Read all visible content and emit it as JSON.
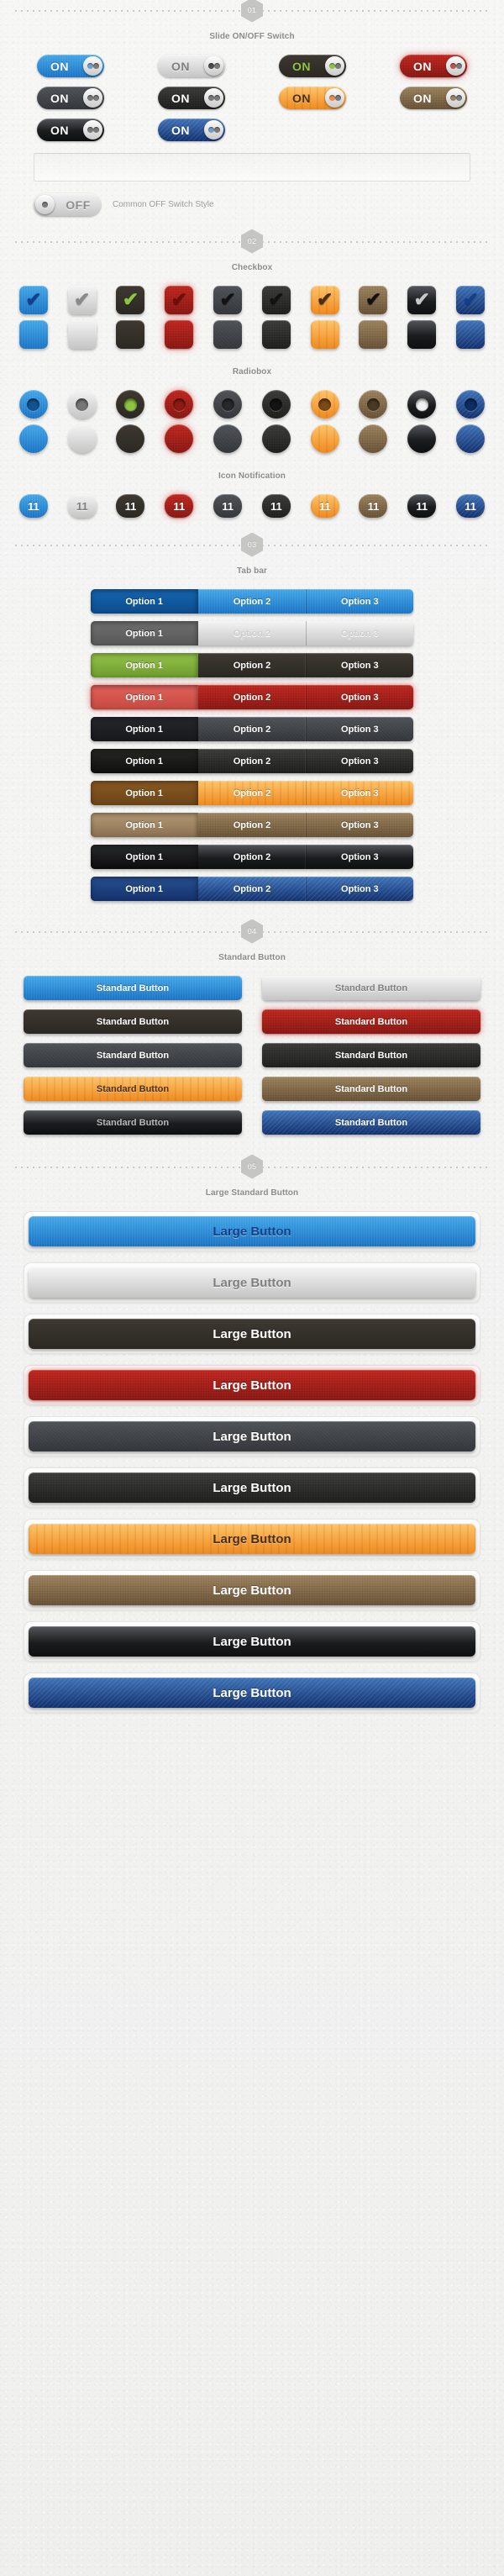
{
  "sections": [
    {
      "badge": "01",
      "title": "Slide ON/OFF Switch"
    },
    {
      "badge": "02",
      "title": "Checkbox"
    },
    {
      "badge": "03",
      "title": "Tab bar"
    },
    {
      "badge": "04",
      "title": "Standard Button"
    },
    {
      "badge": "05",
      "title": "Large Standard Button"
    }
  ],
  "subtitles": {
    "radiobox": "Radiobox",
    "icon_notification": "Icon Notification"
  },
  "switches": {
    "on_label": "ON",
    "off_label": "OFF",
    "off_caption": "Common OFF Switch Style",
    "items": [
      {
        "theme": "blue",
        "label": "ON",
        "text_class": "c-white",
        "knob": "k-blue"
      },
      {
        "theme": "silver",
        "label": "ON",
        "text_class": "c-gray",
        "knob": "k-dark"
      },
      {
        "theme": "darkgreen",
        "label": "ON",
        "text_class": "c-green",
        "knob": "k-green"
      },
      {
        "theme": "red",
        "label": "ON",
        "text_class": "c-white",
        "knob": "k-red"
      },
      {
        "theme": "charcoal",
        "label": "ON",
        "text_class": "c-white",
        "knob": "k-gray"
      },
      {
        "theme": "black",
        "label": "ON",
        "text_class": "c-white",
        "knob": "k-gray"
      },
      {
        "theme": "wood",
        "label": "ON",
        "text_class": "c-darkbr",
        "knob": "k-orange"
      },
      {
        "theme": "brown",
        "label": "ON",
        "text_class": "c-white",
        "knob": "k-brown"
      },
      {
        "theme": "gloss",
        "label": "ON",
        "text_class": "c-white",
        "knob": "k-gray"
      },
      {
        "theme": "denim",
        "label": "ON",
        "text_class": "c-white",
        "knob": "k-blue"
      }
    ]
  },
  "checkbox": {
    "checked_glyph": "✔",
    "items": [
      {
        "theme": "blue",
        "tick_class": "c-navy"
      },
      {
        "theme": "silver",
        "tick_class": "c-gray"
      },
      {
        "theme": "darkgreen",
        "tick_class": "c-green"
      },
      {
        "theme": "red",
        "tick_class": "c-darkred"
      },
      {
        "theme": "charcoal",
        "tick_class": "c-blackish"
      },
      {
        "theme": "black",
        "tick_class": "c-blackish"
      },
      {
        "theme": "wood",
        "tick_class": "c-darkbr"
      },
      {
        "theme": "brown",
        "tick_class": "c-blackish"
      },
      {
        "theme": "gloss",
        "tick_class": "c-silvertxt"
      },
      {
        "theme": "denim",
        "tick_class": "c-navy"
      }
    ]
  },
  "radiobox": {
    "items": [
      {
        "theme": "blue",
        "dot": "d-blue"
      },
      {
        "theme": "silver",
        "dot": "d-gray"
      },
      {
        "theme": "darkgreen",
        "dot": "d-green"
      },
      {
        "theme": "red",
        "dot": "d-red"
      },
      {
        "theme": "charcoal",
        "dot": "d-dark"
      },
      {
        "theme": "black",
        "dot": "d-black"
      },
      {
        "theme": "wood",
        "dot": "d-wood"
      },
      {
        "theme": "brown",
        "dot": "d-brown"
      },
      {
        "theme": "gloss",
        "dot": "d-white"
      },
      {
        "theme": "denim",
        "dot": "d-navy"
      }
    ]
  },
  "notification": {
    "count": "11",
    "items": [
      {
        "theme": "blue",
        "text_class": "c-white"
      },
      {
        "theme": "silver",
        "text_class": "c-gray"
      },
      {
        "theme": "darkgreen",
        "text_class": "c-white"
      },
      {
        "theme": "red",
        "text_class": "c-white"
      },
      {
        "theme": "charcoal",
        "text_class": "c-white"
      },
      {
        "theme": "black",
        "text_class": "c-white"
      },
      {
        "theme": "wood",
        "text_class": "c-white"
      },
      {
        "theme": "brown",
        "text_class": "c-white"
      },
      {
        "theme": "gloss",
        "text_class": "c-white"
      },
      {
        "theme": "denim",
        "text_class": "c-white"
      }
    ]
  },
  "tabbar": {
    "options": [
      "Option 1",
      "Option 2",
      "Option 3"
    ],
    "active_index": 0,
    "rows": [
      {
        "theme": "blue",
        "text_class": "c-white"
      },
      {
        "theme": "silver",
        "text_class": "c-gray"
      },
      {
        "theme": "darkgreen",
        "text_class": "c-white"
      },
      {
        "theme": "red",
        "text_class": "c-white"
      },
      {
        "theme": "charcoal",
        "text_class": "c-white"
      },
      {
        "theme": "black",
        "text_class": "c-white"
      },
      {
        "theme": "wood",
        "text_class": "c-white"
      },
      {
        "theme": "brown",
        "text_class": "c-white"
      },
      {
        "theme": "gloss",
        "text_class": "c-white"
      },
      {
        "theme": "denim",
        "text_class": "c-white"
      }
    ]
  },
  "standard_button": {
    "label": "Standard Button",
    "items": [
      {
        "theme": "blue",
        "text_class": "c-white"
      },
      {
        "theme": "silver",
        "text_class": "c-gray"
      },
      {
        "theme": "darkgreen",
        "text_class": "c-white"
      },
      {
        "theme": "red",
        "text_class": "c-white"
      },
      {
        "theme": "charcoal",
        "text_class": "c-white"
      },
      {
        "theme": "black",
        "text_class": "c-white"
      },
      {
        "theme": "wood",
        "text_class": "c-darkbr"
      },
      {
        "theme": "brown",
        "text_class": "c-white"
      },
      {
        "theme": "gloss",
        "text_class": "c-silvertxt"
      },
      {
        "theme": "denim",
        "text_class": "c-white"
      }
    ]
  },
  "large_button": {
    "label": "Large Button",
    "items": [
      {
        "theme": "blue",
        "text_class": "c-navy"
      },
      {
        "theme": "silver",
        "text_class": "c-gray"
      },
      {
        "theme": "darkgreen",
        "text_class": "c-white"
      },
      {
        "theme": "red",
        "text_class": "c-white"
      },
      {
        "theme": "charcoal",
        "text_class": "c-white"
      },
      {
        "theme": "black",
        "text_class": "c-white"
      },
      {
        "theme": "wood",
        "text_class": "c-darkbr"
      },
      {
        "theme": "brown",
        "text_class": "c-white"
      },
      {
        "theme": "gloss",
        "text_class": "c-white"
      },
      {
        "theme": "denim",
        "text_class": "c-white"
      }
    ]
  }
}
